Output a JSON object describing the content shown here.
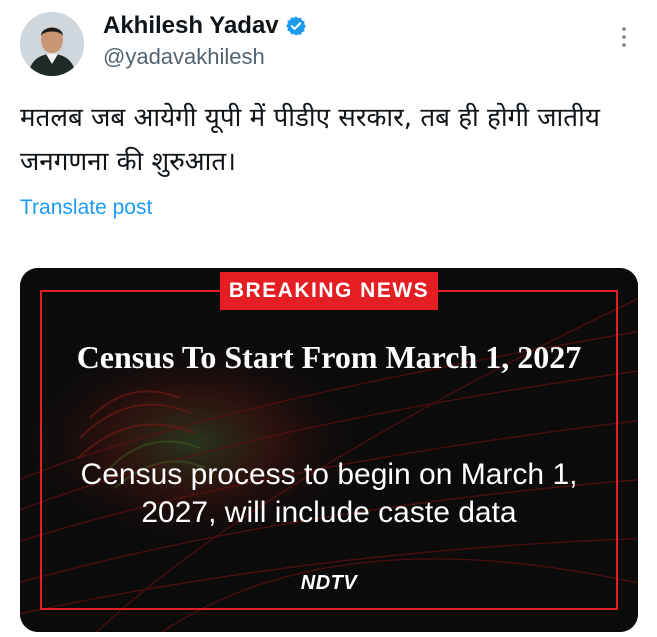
{
  "author": {
    "display_name": "Akhilesh Yadav",
    "handle": "@yadavakhilesh",
    "verified": true,
    "avatar_icon": "profile-photo"
  },
  "post": {
    "text": "मतलब जब आयेगी यूपी में पीडीए सरकार, तब ही होगी जातीय जनगणना की शुरुआत।",
    "translate_label": "Translate post"
  },
  "media": {
    "badge": "BREAKING NEWS",
    "headline": "Census To Start From March 1, 2027",
    "subheadline": "Census process to begin on March 1, 2027, will include caste data",
    "logo": "NDTV",
    "colors": {
      "accent": "#e41e22",
      "background": "#0a0a0a"
    }
  },
  "icons": {
    "verified": "verified-badge-icon",
    "more": "more-options-icon"
  },
  "colors": {
    "link": "#1d9bf0",
    "muted": "#536471",
    "text": "#0f1419"
  }
}
